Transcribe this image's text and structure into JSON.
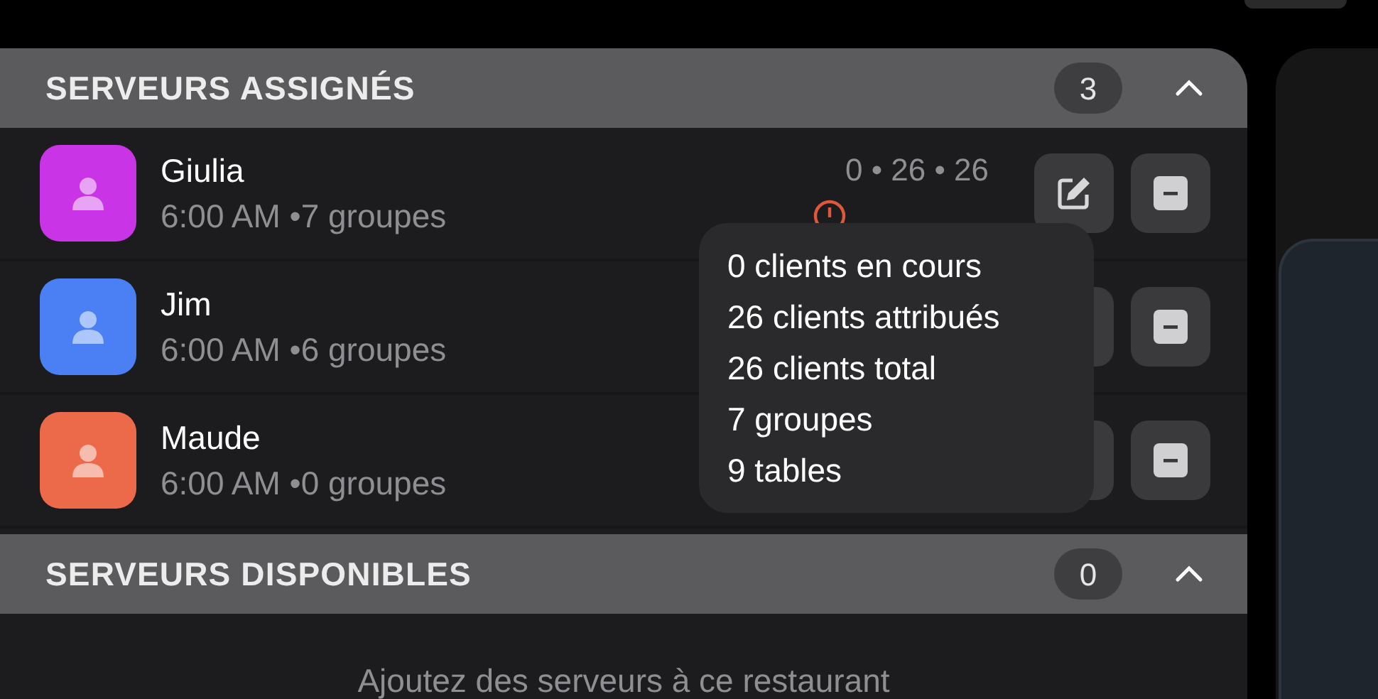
{
  "sections": [
    {
      "title": "SERVEURS ASSIGNÉS",
      "count": "3",
      "expanded": true,
      "servers": [
        {
          "name": "Giulia",
          "shift": "6:00 AM",
          "groups": "•7 groupes",
          "color": "#c935e6",
          "stats": "0 • 26 • 26"
        },
        {
          "name": "Jim",
          "shift": "6:00 AM",
          "groups": "•6 groupes",
          "color": "#4b80f5"
        },
        {
          "name": "Maude",
          "shift": "6:00 AM",
          "groups": "•0 groupes",
          "color": "#ec6a4a"
        }
      ]
    },
    {
      "title": "SERVEURS DISPONIBLES",
      "count": "0",
      "expanded": true,
      "empty_text": "Ajoutez des serveurs à ce restaurant"
    }
  ],
  "tooltip": {
    "lines": [
      "0 clients en cours",
      "26 clients attribués",
      "26 clients total",
      "7 groupes",
      "9 tables"
    ]
  }
}
